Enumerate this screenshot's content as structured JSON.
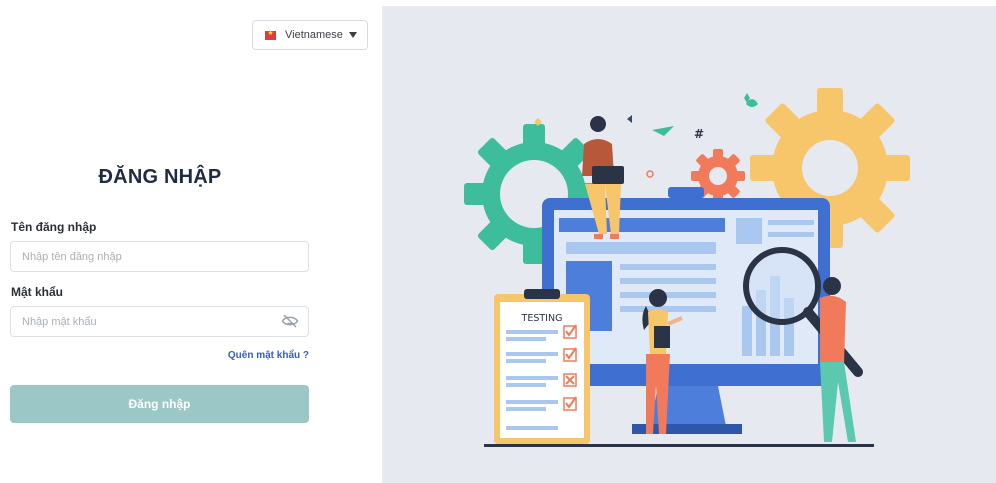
{
  "language": {
    "selected": "Vietnamese",
    "flag_icon": "vietnam-flag-icon"
  },
  "form": {
    "title": "ĐĂNG NHẬP",
    "username_label": "Tên đăng nhập",
    "username_placeholder": "Nhập tên đăng nhập",
    "password_label": "Mật khẩu",
    "password_placeholder": "Nhập mật khẩu",
    "password_toggle_icon": "eye-off-icon",
    "forgot_password": "Quên mật khẩu ?",
    "submit_label": "Đăng nhập"
  },
  "illustration": {
    "clipboard_title": "TESTING",
    "hashtag": "#"
  },
  "colors": {
    "primary_text": "#1f2a44",
    "link": "#2f5fd0",
    "button_bg": "#9cc7c7",
    "panel_bg": "#e7e9f0",
    "gear_green": "#3dbd9c",
    "gear_yellow": "#f7c56a",
    "gear_orange": "#f07a5a",
    "monitor_blue": "#3e6fd1"
  }
}
